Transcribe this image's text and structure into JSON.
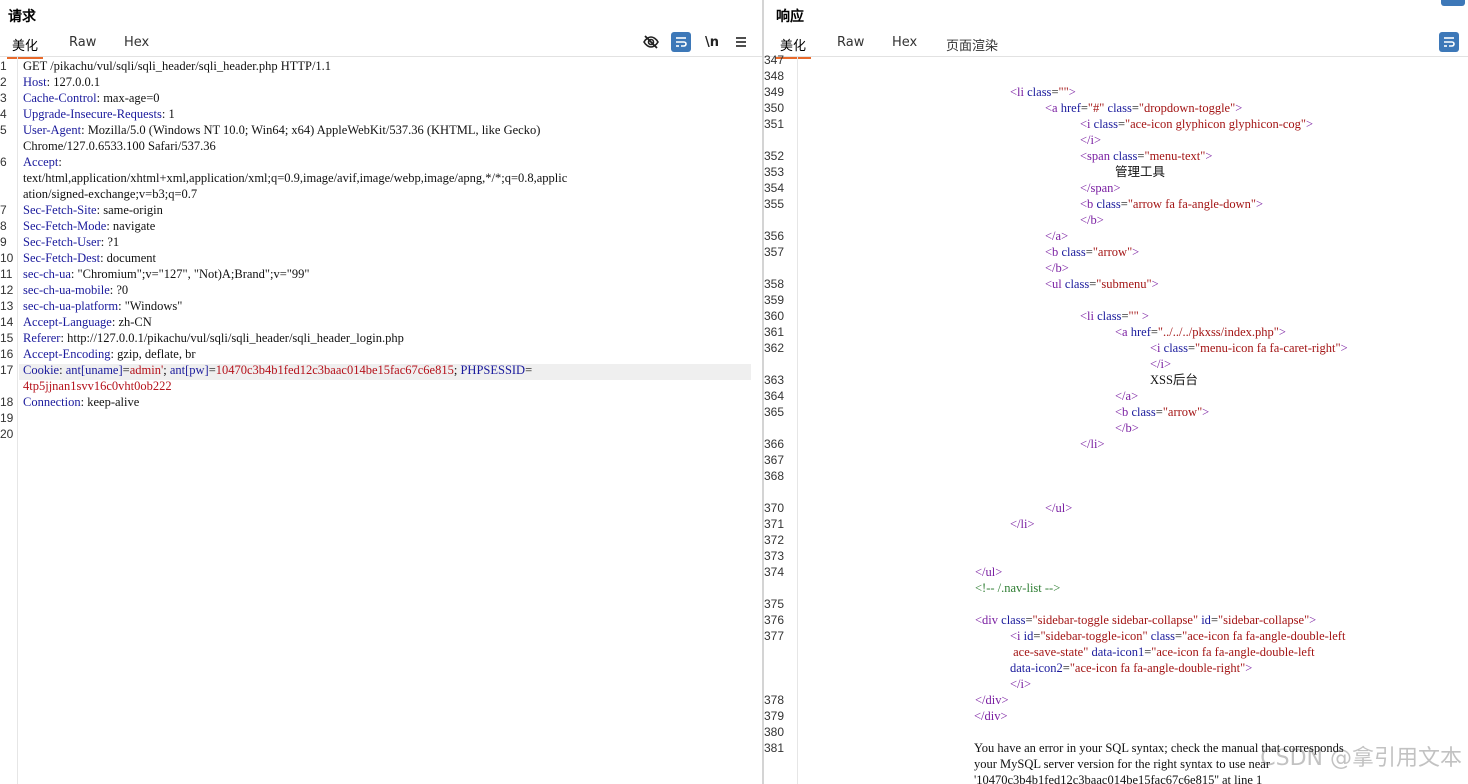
{
  "request": {
    "title": "请求",
    "tabs": [
      "美化",
      "Raw",
      "Hex"
    ],
    "tools": [
      "eye-off-icon",
      "wrap-icon",
      "newline-icon",
      "menu-icon"
    ],
    "newline_label": "\\n",
    "line_numbers": [
      "1",
      "2",
      "3",
      "4",
      "5",
      "",
      "6",
      "",
      "",
      "7",
      "8",
      "9",
      "10",
      "11",
      "12",
      "13",
      "14",
      "15",
      "16",
      "17",
      "",
      "18",
      "19",
      "20"
    ],
    "lines": [
      {
        "k": "GET /pikachu/vul/sqli/sqli_header/sqli_header.php HTTP/1.1",
        "v": ""
      },
      {
        "k": "Host",
        "v": " 127.0.0.1"
      },
      {
        "k": "Cache-Control",
        "v": " max-age=0"
      },
      {
        "k": "Upgrade-Insecure-Requests",
        "v": " 1"
      },
      {
        "k": "User-Agent",
        "v": " Mozilla/5.0 (Windows NT 10.0; Win64; x64) AppleWebKit/537.36 (KHTML, like Gecko)"
      },
      {
        "k": "",
        "v": "Chrome/127.0.6533.100 Safari/537.36"
      },
      {
        "k": "Accept",
        "v": ""
      },
      {
        "k": "",
        "v": "text/html,application/xhtml+xml,application/xml;q=0.9,image/avif,image/webp,image/apng,*/*;q=0.8,applic"
      },
      {
        "k": "",
        "v": "ation/signed-exchange;v=b3;q=0.7"
      },
      {
        "k": "Sec-Fetch-Site",
        "v": " same-origin"
      },
      {
        "k": "Sec-Fetch-Mode",
        "v": " navigate"
      },
      {
        "k": "Sec-Fetch-User",
        "v": " ?1"
      },
      {
        "k": "Sec-Fetch-Dest",
        "v": " document"
      },
      {
        "k": "sec-ch-ua",
        "v": " \"Chromium\";v=\"127\", \"Not)A;Brand\";v=\"99\""
      },
      {
        "k": "sec-ch-ua-mobile",
        "v": " ?0"
      },
      {
        "k": "sec-ch-ua-platform",
        "v": " \"Windows\""
      },
      {
        "k": "Accept-Language",
        "v": " zh-CN"
      },
      {
        "k": "Referer",
        "v": " http://127.0.0.1/pikachu/vul/sqli/sqli_header/sqli_header_login.php"
      },
      {
        "k": "Accept-Encoding",
        "v": " gzip, deflate, br"
      }
    ],
    "cookie": {
      "key": "Cookie",
      "parts": [
        {
          "k": "ant[uname]",
          "v": "admin'"
        },
        {
          "k": "ant[pw]",
          "v": "10470c3b4b1fed12c3baac014be15fac67c6e815"
        },
        {
          "k": "PHPSESSID",
          "v": ""
        }
      ],
      "cont": "4tp5jjnan1svv16c0vht0ob222"
    },
    "last": {
      "k": "Connection",
      "v": " keep-alive"
    }
  },
  "response": {
    "title": "响应",
    "tabs": [
      "美化",
      "Raw",
      "Hex",
      "页面渲染"
    ],
    "line_numbers": [
      "347",
      "348",
      "349",
      "350",
      "351",
      "",
      "352",
      "353",
      "354",
      "355",
      "",
      "356",
      "357",
      "",
      "358",
      "359",
      "360",
      "361",
      "362",
      "",
      "363",
      "364",
      "365",
      "",
      "366",
      "367",
      "368",
      "",
      "370",
      "371",
      "372",
      "373",
      "374",
      "",
      "375",
      "376",
      "377",
      "",
      "",
      "",
      "378",
      "379",
      "380",
      "381"
    ],
    "lines": [
      {
        "indent": 0,
        "html": ""
      },
      {
        "indent": 0,
        "html": ""
      },
      {
        "indent": 1,
        "t": "<li class=\"\">"
      },
      {
        "indent": 2,
        "t": "<a href=\"#\" class=\"dropdown-toggle\">"
      },
      {
        "indent": 3,
        "t": "<i class=\"ace-icon glyphicon glyphicon-cog\">"
      },
      {
        "indent": 3,
        "t": "</i>"
      },
      {
        "indent": 3,
        "t": "<span class=\"menu-text\">"
      },
      {
        "indent": 4,
        "t": "管理工具"
      },
      {
        "indent": 3,
        "t": "</span>"
      },
      {
        "indent": 3,
        "t": "<b class=\"arrow fa fa-angle-down\">"
      },
      {
        "indent": 3,
        "t": "</b>"
      },
      {
        "indent": 2,
        "t": "</a>"
      },
      {
        "indent": 2,
        "t": "<b class=\"arrow\">"
      },
      {
        "indent": 2,
        "t": "</b>"
      },
      {
        "indent": 2,
        "t": "<ul class=\"submenu\">"
      },
      {
        "indent": 0,
        "t": ""
      },
      {
        "indent": 3,
        "t": "<li class=\"\" >"
      },
      {
        "indent": 4,
        "t": "<a href=\"../../../pkxss/index.php\">"
      },
      {
        "indent": 5,
        "t": "<i class=\"menu-icon fa fa-caret-right\">"
      },
      {
        "indent": 5,
        "t": "</i>"
      },
      {
        "indent": 5,
        "t": "XSS后台"
      },
      {
        "indent": 4,
        "t": "</a>"
      },
      {
        "indent": 4,
        "t": "<b class=\"arrow\">"
      },
      {
        "indent": 4,
        "t": "</b>"
      },
      {
        "indent": 3,
        "t": "</li>"
      },
      {
        "indent": 0,
        "t": ""
      },
      {
        "indent": 0,
        "t": ""
      },
      {
        "indent": 0,
        "t": ""
      },
      {
        "indent": 2,
        "t": "</ul>"
      },
      {
        "indent": 1,
        "t": "</li>"
      },
      {
        "indent": 0,
        "t": ""
      },
      {
        "indent": 0,
        "t": ""
      },
      {
        "indent": 0,
        "t": "</ul>"
      },
      {
        "indent": 0,
        "t": "<!-- /.nav-list -->"
      },
      {
        "indent": 0,
        "t": ""
      },
      {
        "indent": 0,
        "t": "<div class=\"sidebar-toggle sidebar-collapse\" id=\"sidebar-collapse\">"
      },
      {
        "indent": 1,
        "t": "<i id=\"sidebar-toggle-icon\" class=\"ace-icon fa fa-angle-double-left"
      },
      {
        "indent": 1,
        "t": " ace-save-state\" data-icon1=\"ace-icon fa fa-angle-double-left"
      },
      {
        "indent": 1,
        "t": "data-icon2=\"ace-icon fa fa-angle-double-right\">"
      },
      {
        "indent": 1,
        "t": "</i>"
      },
      {
        "indent": 0,
        "t": "</div>"
      },
      {
        "indent": -1,
        "t": "</div>"
      },
      {
        "indent": 0,
        "t": ""
      },
      {
        "indent": -1,
        "t": "You have an error in your SQL syntax; check the manual that corresponds"
      },
      {
        "indent": -1,
        "t": "your MySQL server version for the right syntax to use near"
      },
      {
        "indent": -1,
        "t": "'10470c3b4b1fed12c3baac014be15fac67c6e815'' at line 1"
      }
    ]
  },
  "watermark": "CSDN @拿引用文本"
}
